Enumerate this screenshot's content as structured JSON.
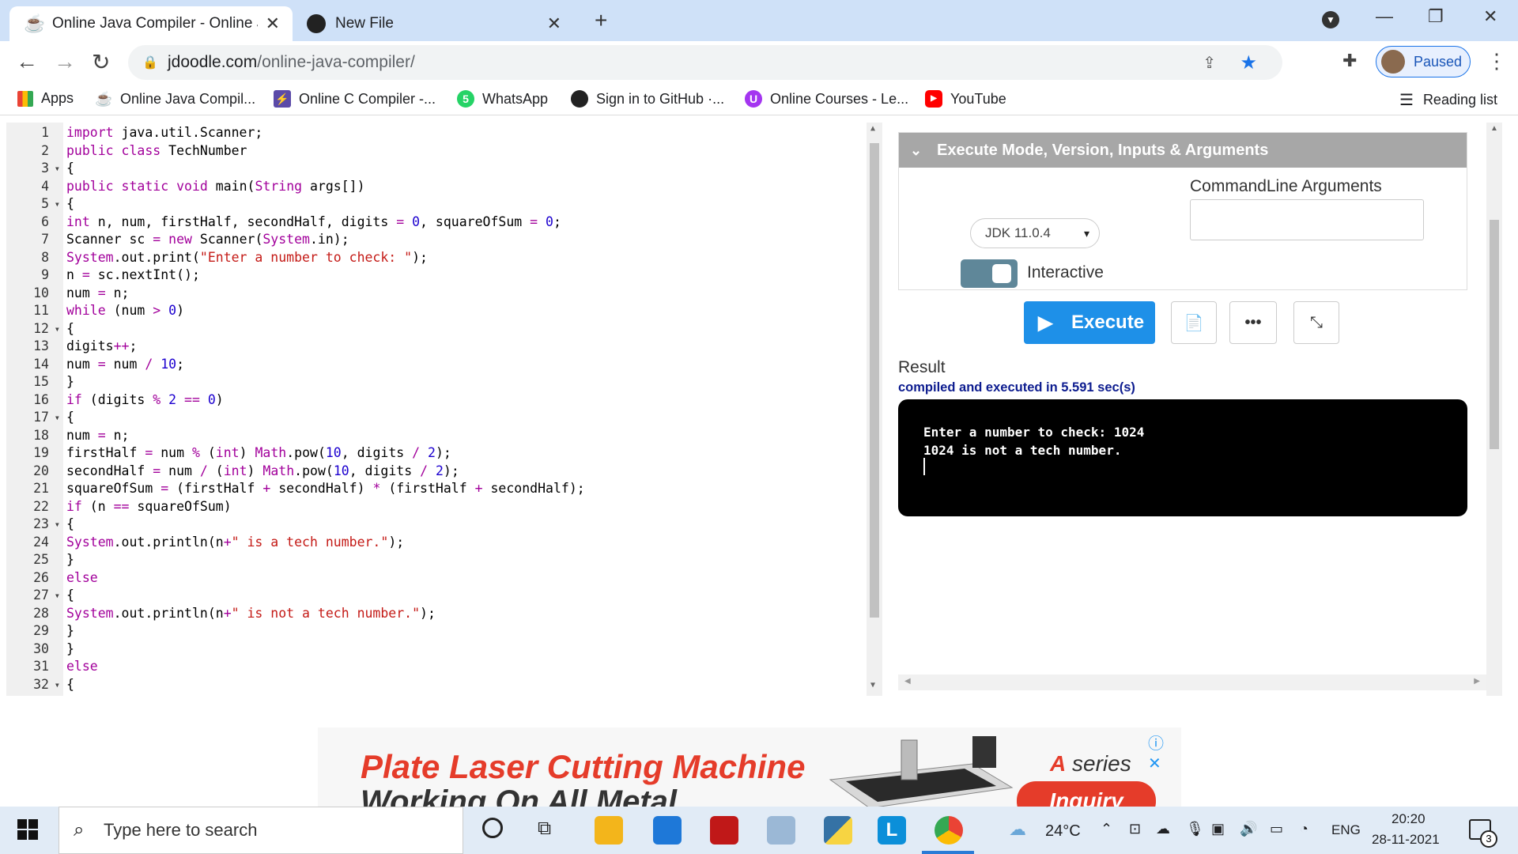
{
  "browser": {
    "tabs": [
      {
        "title": "Online Java Compiler - Online Ja",
        "active": true
      },
      {
        "title": "New File",
        "active": false
      }
    ],
    "url_host": "jdoodle.com",
    "url_path": "/online-java-compiler/",
    "profile_label": "Paused",
    "bookmarks": [
      {
        "label": "Apps"
      },
      {
        "label": "Online Java Compil..."
      },
      {
        "label": "Online C Compiler -..."
      },
      {
        "label": "WhatsApp"
      },
      {
        "label": "Sign in to GitHub ·..."
      },
      {
        "label": "Online Courses - Le..."
      },
      {
        "label": "YouTube"
      }
    ],
    "reading_list": "Reading list"
  },
  "editor": {
    "line_numbers": [
      "1",
      "2",
      "3",
      "4",
      "5",
      "6",
      "7",
      "8",
      "9",
      "10",
      "11",
      "12",
      "13",
      "14",
      "15",
      "16",
      "17",
      "18",
      "19",
      "20",
      "21",
      "22",
      "23",
      "24",
      "25",
      "26",
      "27",
      "28",
      "29",
      "30",
      "31",
      "32"
    ],
    "fold_lines": [
      3,
      5,
      12,
      17,
      23,
      27,
      32
    ]
  },
  "panel": {
    "header": "Execute Mode, Version, Inputs & Arguments",
    "jdk_version": "JDK 11.0.4",
    "cmd_args_label": "CommandLine Arguments",
    "interactive_label": "Interactive",
    "execute_label": "Execute",
    "result_label": "Result",
    "status": "compiled and executed in 5.591 sec(s)",
    "output_lines": [
      "Enter a number to check: 1024",
      "1024 is not a tech number."
    ]
  },
  "ad": {
    "title": "Plate Laser Cutting Machine",
    "subtitle": "Working On All Metal",
    "series_a": "A",
    "series_rest": " series",
    "cta": "Inquiry"
  },
  "taskbar": {
    "search_placeholder": "Type here to search",
    "temperature": "24°C",
    "language": "ENG",
    "time": "20:20",
    "date": "28-11-2021",
    "notifications": "3"
  }
}
